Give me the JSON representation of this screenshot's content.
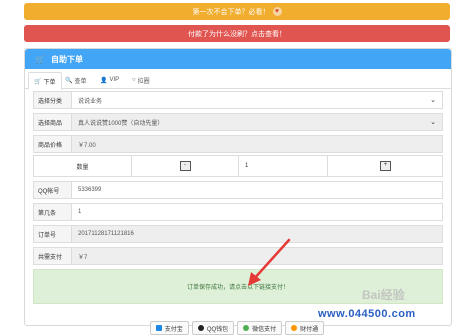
{
  "banners": {
    "first": "第一次不会下单？必看！",
    "second": "付款了为什么没刷？点击查看！"
  },
  "panel": {
    "title": "自助下单"
  },
  "tabs": [
    {
      "label": "下单"
    },
    {
      "label": "查单"
    },
    {
      "label": "VIP"
    },
    {
      "label": "拉圈"
    }
  ],
  "form": {
    "category_label": "选择分类",
    "category_value": "说说业务",
    "product_label": "选择商品",
    "product_value": "真人说说赞1000赞（自动先量）",
    "price_label": "商品价格",
    "price_value": "￥7.00",
    "qty_label": "数量",
    "qty_minus": "-",
    "qty_value": "1",
    "qty_plus": "+",
    "qq_label": "QQ帐号",
    "qq_value": "5336399",
    "which_label": "第几条",
    "which_value": "1",
    "order_label": "订单号",
    "order_value": "20171128171121816",
    "total_label": "共需支付",
    "total_value": "￥7"
  },
  "success_message": "订单保存成功，请点击以下链接支付！",
  "payments": [
    {
      "label": "支付宝",
      "color": "#1e88e5"
    },
    {
      "label": "QQ钱包",
      "color": "#222222"
    },
    {
      "label": "微信支付",
      "color": "#4caf50"
    },
    {
      "label": "财付通",
      "color": "#ff9800"
    }
  ],
  "watermarks": {
    "baidu": "Bai经验",
    "site": "www.044500.com"
  },
  "colors": {
    "orange": "#f0ad2e",
    "red": "#e05550",
    "blue": "#42a5f5",
    "success_bg": "#dff0d8"
  }
}
